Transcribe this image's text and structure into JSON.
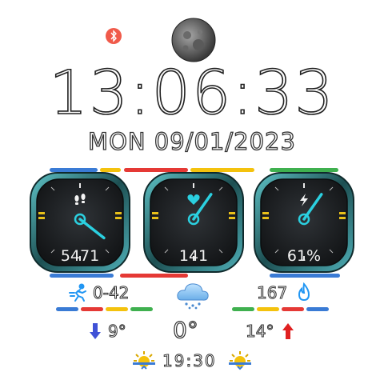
{
  "clock": {
    "time": "13:06:33",
    "date": "MON 09/01/2023"
  },
  "dials": [
    {
      "id": "steps",
      "icon": "footprints-icon",
      "value": "5471",
      "accent": "#2bd0e0"
    },
    {
      "id": "heart",
      "icon": "heart-icon",
      "value": "141",
      "accent": "#2bd0e0"
    },
    {
      "id": "battery",
      "icon": "lightning-icon",
      "value": "61%",
      "accent": "#2bd0e0"
    }
  ],
  "activity": {
    "distance": "0-42",
    "calories": "167"
  },
  "weather": {
    "current": "0°",
    "low": "9°",
    "high": "14°"
  },
  "sun": {
    "time": "19:30"
  },
  "colors": {
    "red": "#e53935",
    "yellow": "#f4c20d",
    "green": "#3fb04f",
    "blue": "#3a7bd5",
    "cyan": "#2bd0e0"
  }
}
